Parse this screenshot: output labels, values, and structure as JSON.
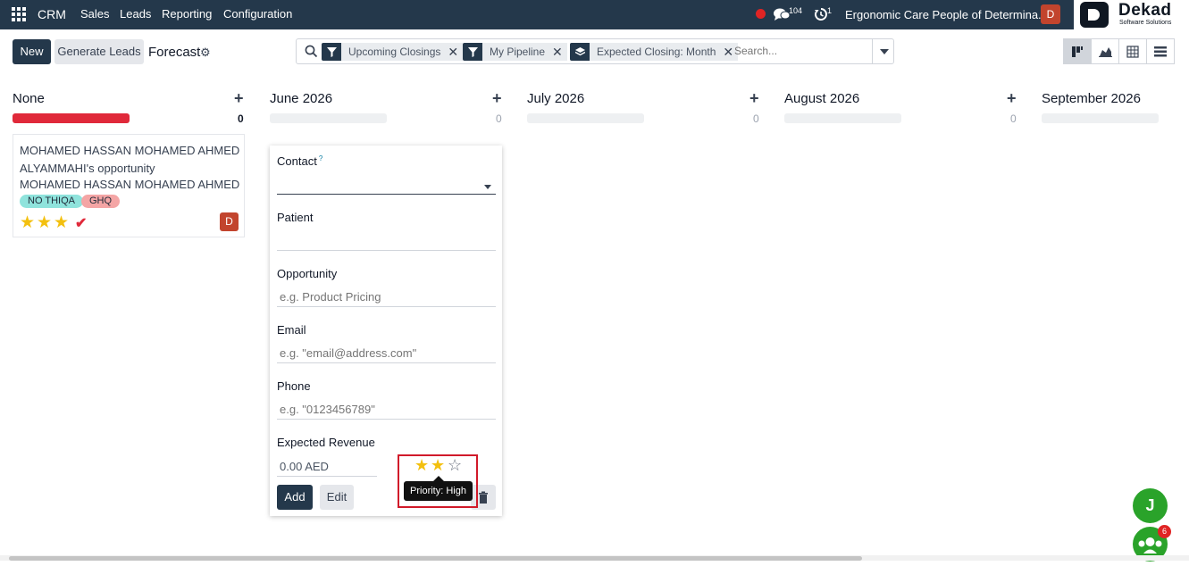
{
  "nav": {
    "brand": "CRM",
    "items": [
      "Sales",
      "Leads",
      "Reporting",
      "Configuration"
    ],
    "chat_count": "104",
    "activity_count": "1",
    "company": "Ergonomic Care People of Determina...",
    "avatar_letter": "D",
    "logo_name": "Dekad",
    "logo_sub": "Software Solutions"
  },
  "control": {
    "new_label": "New",
    "generate_label": "Generate Leads",
    "breadcrumb": "Forecast",
    "facets": [
      "Upcoming Closings",
      "My Pipeline",
      "Expected Closing: Month"
    ],
    "search_placeholder": "Search..."
  },
  "columns": [
    {
      "title": "None",
      "count": "0"
    },
    {
      "title": "June 2026",
      "count": "0"
    },
    {
      "title": "July 2026",
      "count": "0"
    },
    {
      "title": "August 2026",
      "count": "0"
    },
    {
      "title": "September 2026",
      "count": ""
    }
  ],
  "card": {
    "title": "MOHAMED HASSAN MOHAMED AHMED ALYAMMAHI's opportunity",
    "contact": "MOHAMED HASSAN MOHAMED AHMED A...",
    "tags": [
      {
        "label": "NO THIQA",
        "color": "#8fe3dc"
      },
      {
        "label": "GHQ",
        "color": "#f4a5a5"
      }
    ],
    "stars": 3,
    "avatar_letter": "D"
  },
  "quick_create": {
    "contact_label": "Contact",
    "contact_help": "?",
    "patient_label": "Patient",
    "opportunity_label": "Opportunity",
    "opportunity_placeholder": "e.g. Product Pricing",
    "email_label": "Email",
    "email_placeholder": "e.g. \"email@address.com\"",
    "phone_label": "Phone",
    "phone_placeholder": "e.g. \"0123456789\"",
    "revenue_label": "Expected Revenue",
    "revenue_value": "0.00 AED",
    "add_label": "Add",
    "edit_label": "Edit",
    "priority_stars_filled": 2,
    "priority_tooltip": "Priority: High"
  },
  "floating": {
    "chat_letter": "J",
    "team_badge": "6"
  },
  "colors": {
    "nav_bg": "#24384b",
    "primary": "#24384b",
    "danger_bar": "#e0293a",
    "star": "#f3c00f",
    "highlight": "#d11a2a"
  }
}
